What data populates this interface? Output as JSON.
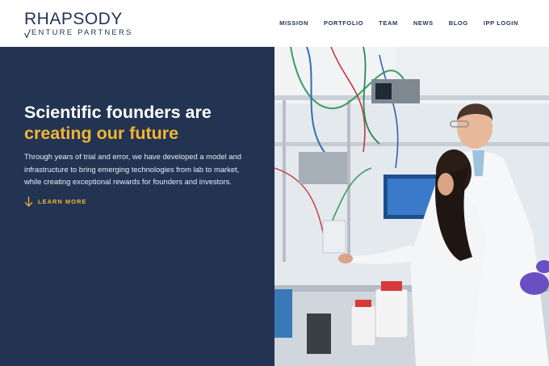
{
  "brand": {
    "name": "RHAPSODY",
    "tagline": "ENTURE PARTNERS"
  },
  "nav": {
    "items": [
      {
        "label": "MISSION"
      },
      {
        "label": "PORTFOLIO"
      },
      {
        "label": "TEAM"
      },
      {
        "label": "NEWS"
      },
      {
        "label": "BLOG"
      },
      {
        "label": "IPP LOGIN"
      }
    ]
  },
  "hero": {
    "title_line1": "Scientific founders are",
    "title_line2": "creating our future",
    "description": "Through years of trial and error, we have developed a model and infrastructure to bring emerging technologies from lab to market, while creating exceptional rewards for founders and investors.",
    "cta_label": "LEARN MORE",
    "cta_icon": "arrow-down-icon"
  },
  "colors": {
    "navy": "#233453",
    "accent": "#f2b533",
    "nav_text": "#243456"
  }
}
